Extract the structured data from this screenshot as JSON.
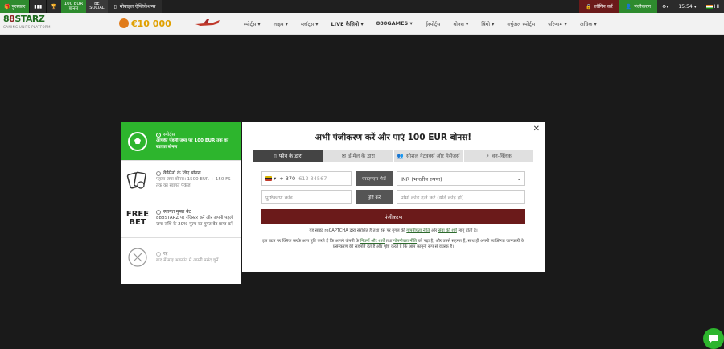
{
  "topbar": {
    "bonus_label": "पुरस्कार",
    "money_line1": "100 EUR",
    "money_line2": "बोनस",
    "social_line1": "BE",
    "social_line2": "SOCIAL",
    "app_label": "मोबाइल ऐप्लिकेशन्स",
    "login_label": "लॉगिन करें",
    "register_label": "पंजीकरण",
    "time": "15:54",
    "lang": "HI"
  },
  "navbar": {
    "logo_prefix": "8",
    "logo_accent": "8",
    "logo_rest": "STARZ",
    "logo_sub": "GAMING UNITS PLATFORM",
    "promo_amount": "€10 000",
    "items": [
      {
        "label": "स्पोर्ट्स ▾",
        "bold": false
      },
      {
        "label": "लाइव ▾",
        "bold": false
      },
      {
        "label": "स्लॉट्स ▾",
        "bold": false
      },
      {
        "label": "LIVE कैसिनो ▾",
        "bold": true
      },
      {
        "label": "888GAMES ▾",
        "bold": true
      },
      {
        "label": "ईस्पोर्ट्स",
        "bold": false
      },
      {
        "label": "बोनस ▾",
        "bold": false
      },
      {
        "label": "बिंगो ▾",
        "bold": false
      },
      {
        "label": "वर्चुअल स्पोर्ट्स",
        "bold": false
      },
      {
        "label": "परिणाम ▾",
        "bold": false
      },
      {
        "label": "अधिक ▾",
        "bold": false
      }
    ]
  },
  "bonus_options": [
    {
      "title": "स्पोर्ट्स",
      "desc": "आपकी पहली जमा पर 100 EUR तक का स्वागत बोनस"
    },
    {
      "title": "कैसिनो के लिए बोनस",
      "desc": "पहला जमा बोनस। 1500 EUR + 150 FS तक का स्वागत पैकेज"
    },
    {
      "title": "स्वागत मुफ्त बेट",
      "desc": "888STARZ पर रजिस्टर करें और अपनी पहली जमा राशि के 20% मूल्य का मुफ्त बेट प्राप्त करें",
      "icon_line1": "FREE",
      "icon_line2": "BET"
    },
    {
      "title": "रद्द",
      "desc": "बाद में माइ अकाउंट में अपनी पसंद चुनें"
    }
  ],
  "modal": {
    "title": "अभी पंजीकरण करें और पाएं 100 EUR बोनस!",
    "close_symbol": "✕",
    "tabs": [
      {
        "label": "फोन के द्वारा",
        "icon": "phone-icon"
      },
      {
        "label": "ई-मेल के द्वारा",
        "icon": "envelope-icon"
      },
      {
        "label": "सोशल नेटवर्क्स और मैसेंजर्स",
        "icon": "users-icon"
      },
      {
        "label": "वन-क्लिक",
        "icon": "lightning-icon"
      }
    ],
    "phone_code": "+ 370",
    "phone_placeholder": "612 34567",
    "send_sms_label": "एसएमएस भेजें",
    "currency_value": "INR (भारतीय रुपया)",
    "confirm_code_placeholder": "पुष्टिकरण कोड",
    "confirm_label": "पुष्टि करें",
    "promo_placeholder": "प्रोमो कोड दर्ज करें (यदि कोई हो)",
    "submit_label": "पंजीकरण",
    "recaptcha_prefix": "यह साइट reCAPTCHA द्वारा संरक्षित है तथा इस पर गूगल की",
    "privacy_link": "गोपनीयता नीति",
    "and_word": "और",
    "terms_link": "सेवा की शर्तें",
    "recaptcha_suffix": "लागू होती हैं।",
    "consent_part1": "इस बटन पर क्लिक करके आप पुष्टि करते हैं कि आपने कंपनी के",
    "consent_link1": "नियमों और शर्तों",
    "consent_part2": "तथा",
    "consent_link2": "गोपनीयता नीति",
    "consent_part3": "को पढ़ा है, और उनसे सहमत हैं, साथ ही अपनी व्यक्तिगत जानकारी के प्रसंस्करण की सहमति देते हैं और पुष्टि करते हैं कि आप कानूनी रूप से वयस्क हैं।"
  },
  "colors": {
    "green": "#2db52d",
    "maroon": "#6b1a1a",
    "overlay": "#1a1a1a"
  }
}
